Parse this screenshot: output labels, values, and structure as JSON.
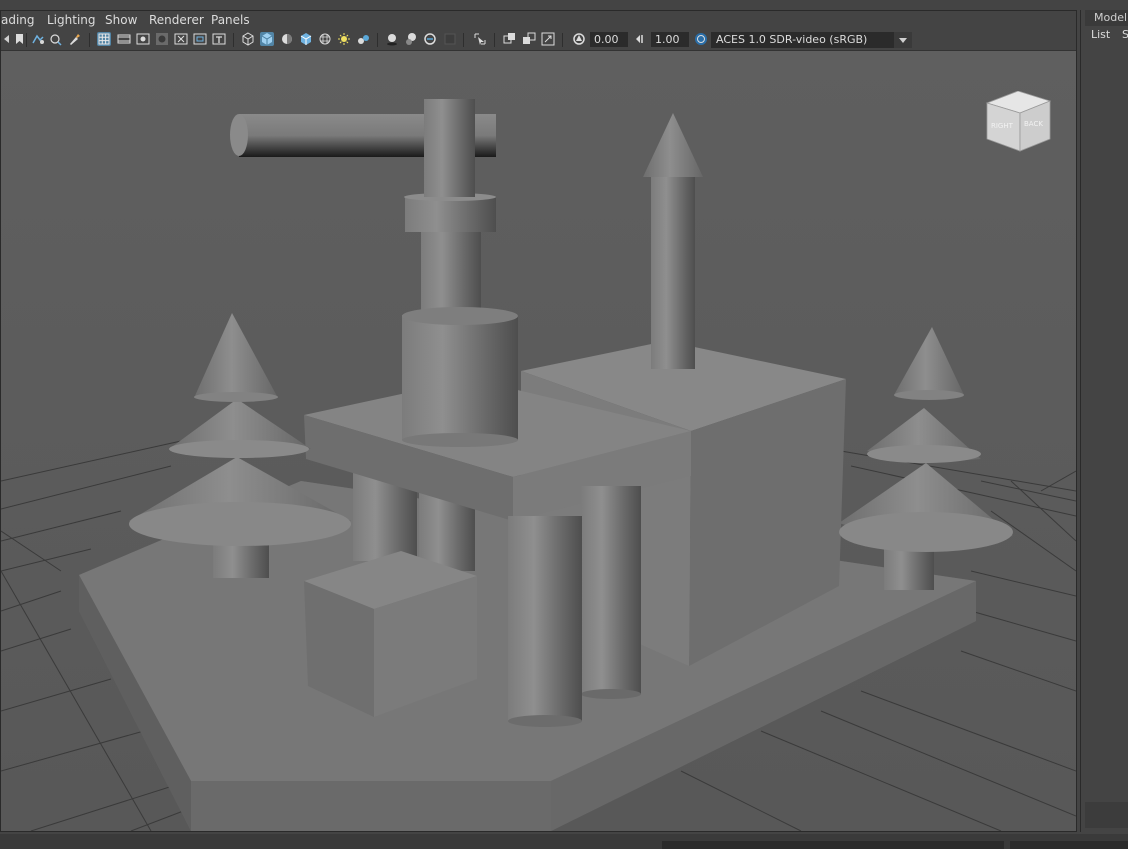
{
  "menubar": {
    "items": [
      "ading",
      "Lighting",
      "Show",
      "Renderer",
      "Panels"
    ]
  },
  "toolbar": {
    "exposure_value": "0.00",
    "gamma_value": "1.00",
    "colorspace": "ACES 1.0 SDR-video (sRGB)",
    "icons": [
      "camera-icon",
      "bookmark-icon",
      "camera-attr-icon",
      "gate-icon",
      "brush-icon",
      "grid-icon",
      "film-gate-icon",
      "resolution-gate-icon",
      "gate-mask-icon",
      "field-chart-icon",
      "safe-action-icon",
      "safe-title-icon",
      "wireframe-icon",
      "smooth-shade-icon",
      "default-material-icon",
      "wireframe-on-shaded-icon",
      "xray-icon",
      "textured-icon",
      "use-lights-icon",
      "shadows-icon",
      "screen-space-ao-icon",
      "motion-blur-icon",
      "multisample-aa-icon",
      "depth-of-field-icon",
      "isolate-select-icon",
      "xray-joints-icon",
      "xray-active-icon",
      "backface-culling-icon",
      "exposure-icon",
      "gamma-icon",
      "color-management-icon"
    ]
  },
  "viewcube": {
    "face_left": "RIGHT",
    "face_right": "BACK"
  },
  "right_panel": {
    "tab_label": "Model",
    "menu_list": "List",
    "menu_s": "S"
  },
  "colors": {
    "viewport_bg": "#5c5c5c",
    "ui_bg": "#444444",
    "active_icon": "#5285a6"
  }
}
